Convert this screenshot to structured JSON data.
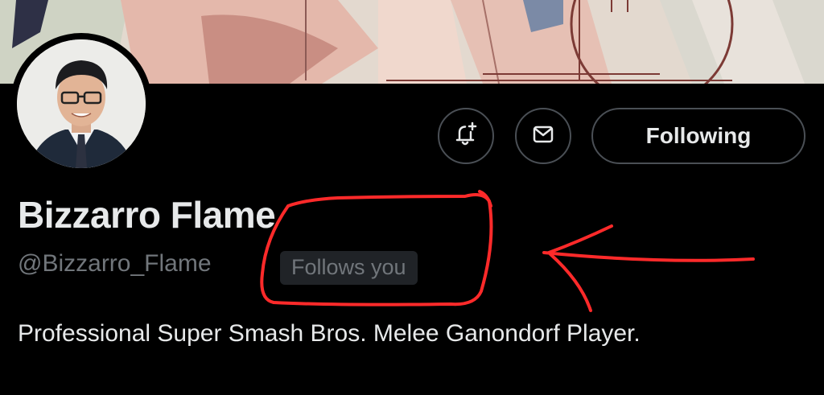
{
  "profile": {
    "display_name": "Bizzarro Flame",
    "handle": "@Bizzarro_Flame",
    "follows_you_badge": "Follows you",
    "bio": "Professional Super Smash Bros. Melee Ganondorf Player."
  },
  "actions": {
    "notify_icon": "bell-plus-icon",
    "message_icon": "envelope-icon",
    "following_label": "Following"
  },
  "colors": {
    "background": "#000000",
    "text_primary": "#e7e9ea",
    "text_secondary": "#71767b",
    "button_border": "#4a4f55",
    "badge_background": "#202327",
    "annotation_red": "#ff2a2a"
  }
}
